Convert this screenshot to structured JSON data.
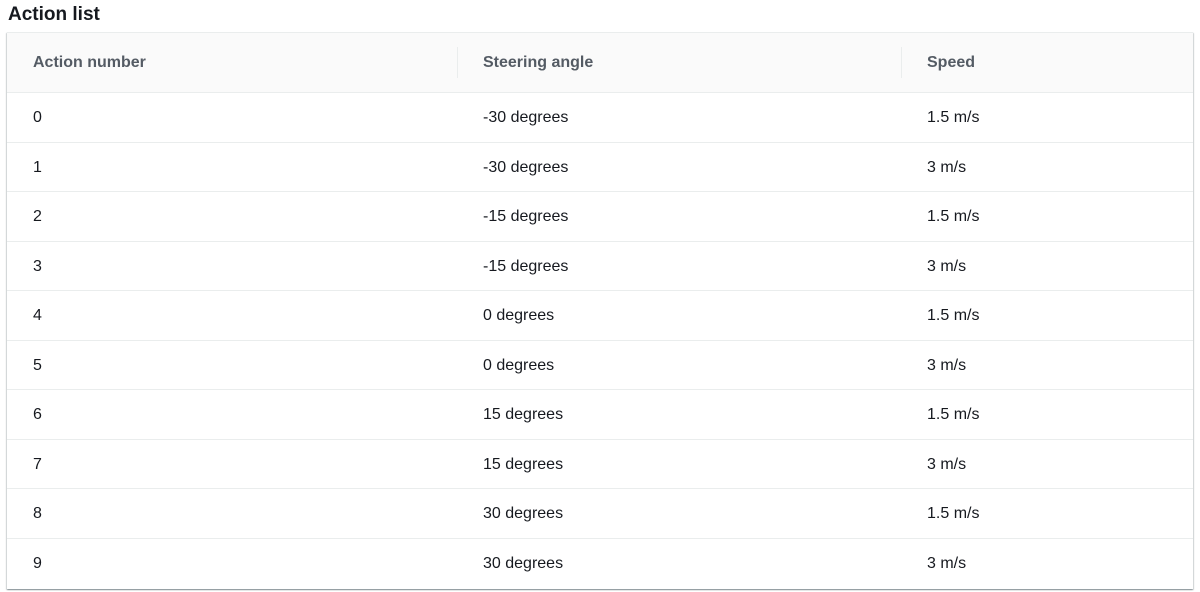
{
  "title": "Action list",
  "table": {
    "columns": [
      "Action number",
      "Steering angle",
      "Speed"
    ],
    "rows": [
      [
        "0",
        "-30 degrees",
        "1.5 m/s"
      ],
      [
        "1",
        "-30 degrees",
        "3 m/s"
      ],
      [
        "2",
        "-15 degrees",
        "1.5 m/s"
      ],
      [
        "3",
        "-15 degrees",
        "3 m/s"
      ],
      [
        "4",
        "0 degrees",
        "1.5 m/s"
      ],
      [
        "5",
        "0 degrees",
        "3 m/s"
      ],
      [
        "6",
        "15 degrees",
        "1.5 m/s"
      ],
      [
        "7",
        "15 degrees",
        "3 m/s"
      ],
      [
        "8",
        "30 degrees",
        "1.5 m/s"
      ],
      [
        "9",
        "30 degrees",
        "3 m/s"
      ]
    ]
  }
}
